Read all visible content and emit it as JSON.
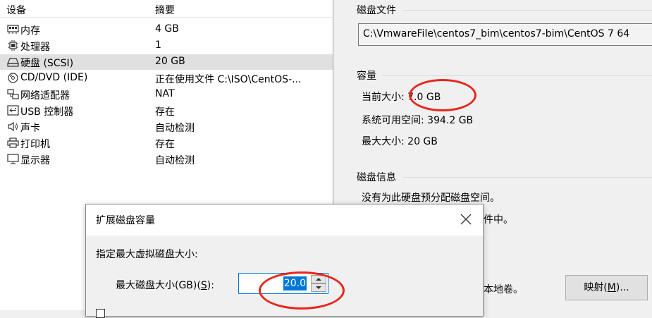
{
  "device_list": {
    "header": {
      "device_col": "设备",
      "summary_col": "摘要"
    },
    "rows": [
      {
        "icon": "memory-icon",
        "name": "内存",
        "summary": "4 GB",
        "selected": false
      },
      {
        "icon": "processor-icon",
        "name": "处理器",
        "summary": "1",
        "selected": false
      },
      {
        "icon": "hard-disk-icon",
        "name": "硬盘 (SCSI)",
        "summary": "20 GB",
        "selected": true
      },
      {
        "icon": "cd-dvd-icon",
        "name": "CD/DVD (IDE)",
        "summary": "正在使用文件 C:\\ISO\\CentOS-...",
        "selected": false
      },
      {
        "icon": "network-adapter-icon",
        "name": "网络适配器",
        "summary": "NAT",
        "selected": false
      },
      {
        "icon": "usb-controller-icon",
        "name": "USB 控制器",
        "summary": "存在",
        "selected": false
      },
      {
        "icon": "sound-card-icon",
        "name": "声卡",
        "summary": "自动检测",
        "selected": false
      },
      {
        "icon": "printer-icon",
        "name": "打印机",
        "summary": "存在",
        "selected": false
      },
      {
        "icon": "display-icon",
        "name": "显示器",
        "summary": "自动检测",
        "selected": false
      }
    ]
  },
  "disk_file": {
    "group_label": "磁盘文件",
    "path": "C:\\VmwareFile\\centos7_bim\\centos7-bim\\CentOS 7 64"
  },
  "capacity": {
    "group_label": "容量",
    "current_label": "当前大小",
    "current_value": "7.0 GB",
    "available_label": "系统可用空间",
    "available_value": "394.2 GB",
    "max_label": "最大大小",
    "max_value": "20 GB"
  },
  "disk_info": {
    "group_label": "磁盘信息",
    "line1": "没有为此硬盘预分配磁盘空间。",
    "line2_fragment": "件中。"
  },
  "utilities": {
    "fragment": "本地卷。",
    "map_button_label": "映射(",
    "map_button_accel": "M",
    "map_button_suffix": ")..."
  },
  "dialog": {
    "title": "扩展磁盘容量",
    "prompt": "指定最大虚拟磁盘大小:",
    "size_label": "最大磁盘大小(GB)(",
    "size_label_accel": "S",
    "size_label_suffix": "):",
    "size_value": "20.0"
  },
  "colors": {
    "selection": "#e0e0e0",
    "highlight": "#0078d7",
    "annotation": "#e8261c"
  }
}
